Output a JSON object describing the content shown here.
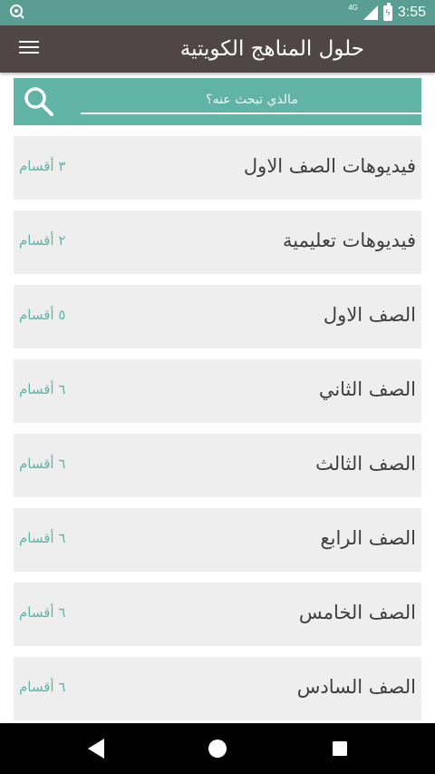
{
  "status_bar": {
    "time": "3:55",
    "network": "4G"
  },
  "app_bar": {
    "title": "حلول المناهج الكويتية"
  },
  "search": {
    "placeholder": "مالذي تبحث عنه؟"
  },
  "items": [
    {
      "title": "فيديوهات الصف الاول",
      "count": "٣ أقسام"
    },
    {
      "title": "فيديوهات تعليمية",
      "count": "٢ أقسام"
    },
    {
      "title": "الصف الاول",
      "count": "٥ أقسام"
    },
    {
      "title": "الصف الثاني",
      "count": "٦ أقسام"
    },
    {
      "title": "الصف الثالث",
      "count": "٦ أقسام"
    },
    {
      "title": "الصف الرابع",
      "count": "٦ أقسام"
    },
    {
      "title": "الصف الخامس",
      "count": "٦ أقسام"
    },
    {
      "title": "الصف السادس",
      "count": "٦ أقسام"
    }
  ],
  "colors": {
    "accent": "#60b3a5",
    "status_bar": "#5a9e93",
    "app_bar": "#504645",
    "item_bg": "#eeeeee",
    "count_text": "#5fb4a6"
  },
  "icons": {
    "menu": "hamburger-icon",
    "search": "search-icon",
    "notification": "notification-icon",
    "signal": "signal-icon",
    "battery": "battery-icon",
    "back": "back-icon",
    "home": "home-icon",
    "recent": "recent-apps-icon"
  }
}
